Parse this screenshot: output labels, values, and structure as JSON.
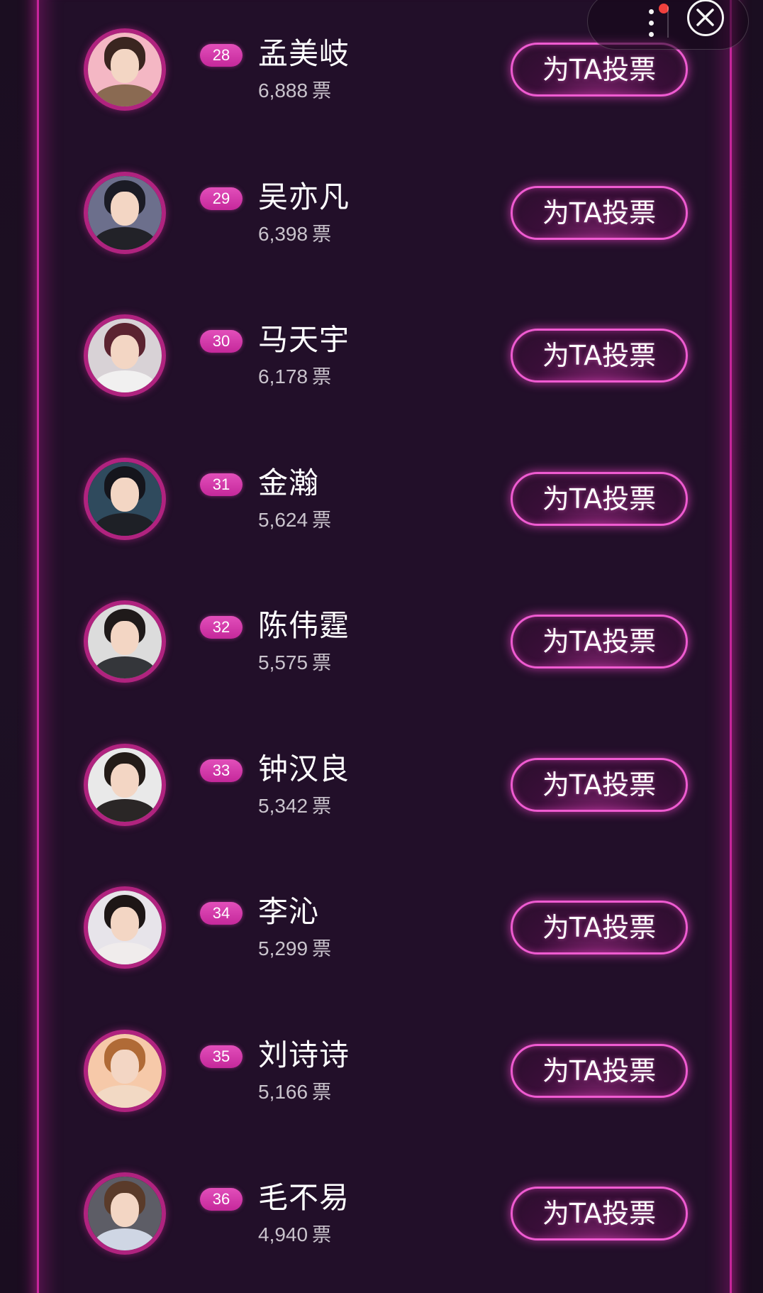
{
  "header": {
    "more_icon": "more-vertical-icon",
    "close_icon": "close-circle-icon",
    "notification_color": "#f1403d"
  },
  "theme": {
    "accent": "#c7259b",
    "button_border": "#ef5bd1",
    "background": "#1b0e21"
  },
  "vote_button_label": "为TA投票",
  "candidates": [
    {
      "rank": "28",
      "name": "孟美岐",
      "votes": "6,888",
      "unit": "票"
    },
    {
      "rank": "29",
      "name": "吴亦凡",
      "votes": "6,398",
      "unit": "票"
    },
    {
      "rank": "30",
      "name": "马天宇",
      "votes": "6,178",
      "unit": "票"
    },
    {
      "rank": "31",
      "name": "金瀚",
      "votes": "5,624",
      "unit": "票"
    },
    {
      "rank": "32",
      "name": "陈伟霆",
      "votes": "5,575",
      "unit": "票"
    },
    {
      "rank": "33",
      "name": "钟汉良",
      "votes": "5,342",
      "unit": "票"
    },
    {
      "rank": "34",
      "name": "李沁",
      "votes": "5,299",
      "unit": "票"
    },
    {
      "rank": "35",
      "name": "刘诗诗",
      "votes": "5,166",
      "unit": "票"
    },
    {
      "rank": "36",
      "name": "毛不易",
      "votes": "4,940",
      "unit": "票"
    }
  ]
}
